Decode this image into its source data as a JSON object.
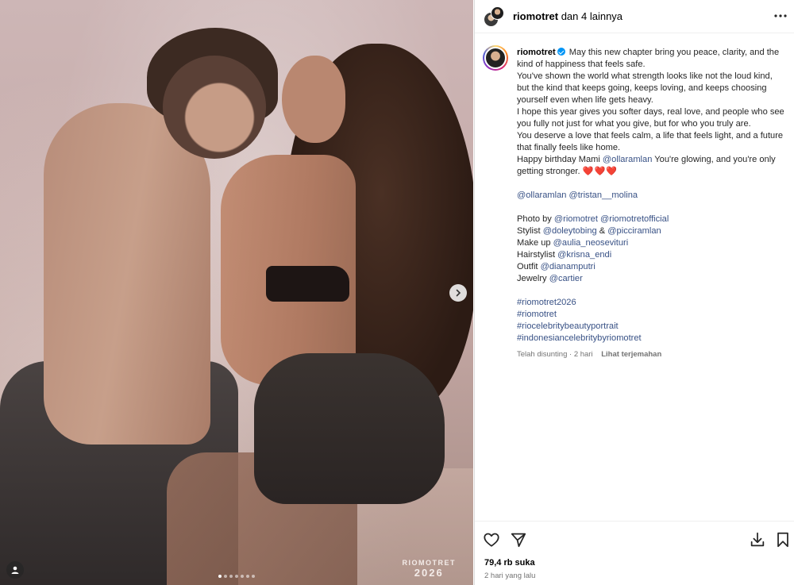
{
  "header": {
    "username": "riomotret",
    "others": "dan 4 lainnya"
  },
  "media": {
    "watermark_brand": "RIOMOTRET",
    "watermark_year": "2026",
    "slide_count": 7,
    "active_slide": 1
  },
  "caption": {
    "username": "riomotret",
    "lines": [
      "May this new chapter bring you peace, clarity, and the kind of happiness that feels safe.",
      "You've shown the world what strength looks like not the loud kind, but the kind that keeps going, keeps loving, and keeps choosing yourself even when life gets heavy.",
      "I hope this year gives you softer days, real love, and people who see you fully not just for what you give, but for who you truly are.",
      "You deserve a love that feels calm, a life that feels light, and a future that finally feels like home."
    ],
    "birthday_prefix": "Happy birthday Mami",
    "birthday_mention": "@ollaramlan",
    "birthday_suffix": "You're glowing, and you're only getting stronger.",
    "hearts": "❤️❤️❤️",
    "mention_1": "@ollaramlan",
    "mention_2": "@tristan__molina",
    "credits": [
      {
        "label": "Photo by",
        "handles": "@riomotret @riomotretofficial"
      },
      {
        "label": "Stylist",
        "handles": "@doleytobing",
        "joiner": "&",
        "handles2": "@picciramlan"
      },
      {
        "label": "Make up",
        "handles": "@aulia_neoseviturі"
      },
      {
        "label": "Hairstylist",
        "handles": "@krisna_endi"
      },
      {
        "label": "Outfit",
        "handles": "@dianamputri"
      },
      {
        "label": "Jewelry",
        "handles": "@cartier"
      }
    ],
    "hashtags": [
      "#riomotret2026",
      "#riomotret",
      "#riocelebritybeautyportrait",
      "#indonesiancelebritybyriomotret"
    ],
    "edited": "Telah disunting · 2 hari",
    "see_translation": "Lihat terjemahan"
  },
  "actions": {
    "likes": "79,4 rb suka",
    "time": "2 hari yang lalu"
  },
  "colors": {
    "link": "#385185",
    "verified": "#0095f6",
    "meta": "#737373"
  }
}
